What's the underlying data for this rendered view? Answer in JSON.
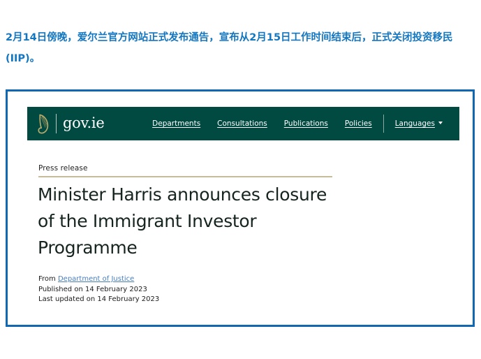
{
  "intro": {
    "text": "2月14日傍晚，爱尔兰官方网站正式发布通告，宣布从2月15日工作时间结束后，正式关闭投资移民(IIP)。",
    "color": "#1376c0"
  },
  "govbar": {
    "background": "#004a42",
    "logo_text": "gov.ie",
    "harp_icon": "harp-icon",
    "nav": [
      {
        "label": "Departments"
      },
      {
        "label": "Consultations"
      },
      {
        "label": "Publications"
      },
      {
        "label": "Policies"
      },
      {
        "label": "Languages",
        "has_caret": true
      }
    ]
  },
  "article": {
    "eyebrow": "Press release",
    "rule_color": "#c6bc9a",
    "headline": "Minister Harris announces closure of the Immigrant Investor Programme",
    "meta": {
      "from_label": "From",
      "from_link": "Department of Justice",
      "published": "Published on 14 February 2023",
      "last_updated": "Last updated on 14 February 2023",
      "link_color": "#4a7ebb"
    }
  },
  "frame": {
    "border_color": "#1167b1"
  }
}
